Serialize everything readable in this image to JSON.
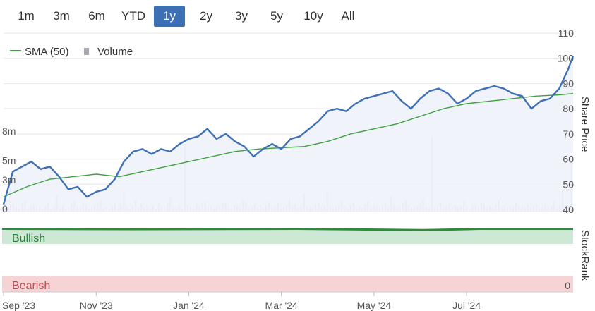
{
  "range_tabs": [
    {
      "label": "1m",
      "active": false
    },
    {
      "label": "3m",
      "active": false
    },
    {
      "label": "6m",
      "active": false
    },
    {
      "label": "YTD",
      "active": false
    },
    {
      "label": "1y",
      "active": true
    },
    {
      "label": "2y",
      "active": false
    },
    {
      "label": "3y",
      "active": false
    },
    {
      "label": "5y",
      "active": false
    },
    {
      "label": "10y",
      "active": false
    },
    {
      "label": "All",
      "active": false
    }
  ],
  "colors": {
    "price": "#3f6fb4",
    "sma": "#3fa13f",
    "volume": "#c0c0c8",
    "bullish": "#cde8d5",
    "bearish": "#f6d3d5",
    "stockrank": "#2f8a3a",
    "active_tab": "#3d70b2"
  },
  "chart_data": [
    {
      "type": "line",
      "legend": [
        {
          "name": "SMA (50)",
          "icon": "line"
        },
        {
          "name": "Volume",
          "icon": "bar"
        }
      ],
      "y_right_label": "Share Price",
      "ylim_right": [
        40,
        110
      ],
      "y_right_ticks": [
        "40",
        "50",
        "60",
        "70",
        "80",
        "90",
        "100",
        "110"
      ],
      "y_left_ticks": [
        "0",
        "3m",
        "5m",
        "8m"
      ],
      "ylim_left": [
        0,
        8
      ],
      "x_ticks": [
        "Sep '23",
        "Nov '23",
        "Jan '24",
        "Mar '24",
        "May '24",
        "Jul '24"
      ],
      "xlim": [
        0,
        12.3
      ],
      "x_tick_positions": [
        0,
        2,
        4,
        6,
        8,
        10
      ],
      "series": [
        {
          "kind": "price",
          "x": [
            0,
            0.2,
            0.4,
            0.6,
            0.8,
            1.0,
            1.1,
            1.2,
            1.4,
            1.6,
            1.8,
            2.0,
            2.2,
            2.4,
            2.6,
            2.8,
            3.0,
            3.2,
            3.4,
            3.6,
            3.8,
            4.0,
            4.2,
            4.4,
            4.6,
            4.8,
            5.0,
            5.2,
            5.4,
            5.6,
            5.8,
            6.0,
            6.2,
            6.4,
            6.6,
            6.8,
            7.0,
            7.2,
            7.4,
            7.6,
            7.8,
            8.0,
            8.2,
            8.4,
            8.6,
            8.8,
            9.0,
            9.2,
            9.4,
            9.6,
            9.8,
            10.0,
            10.2,
            10.4,
            10.6,
            10.8,
            11.0,
            11.2,
            11.4,
            11.6,
            11.8,
            12.0,
            12.1,
            12.2,
            12.3
          ],
          "y": [
            42,
            55,
            57,
            59,
            56,
            57,
            55,
            53,
            48,
            49,
            45,
            47,
            48,
            52,
            59,
            63,
            64,
            62,
            64,
            63,
            66,
            68,
            69,
            72,
            68,
            70,
            67,
            65,
            61,
            64,
            66,
            64,
            68,
            69,
            72,
            75,
            79,
            80,
            79,
            82,
            84,
            85,
            86,
            87,
            83,
            80,
            84,
            87,
            88,
            86,
            82,
            84,
            87,
            88,
            89,
            88,
            86,
            85,
            80,
            83,
            84,
            88,
            92,
            96,
            101
          ]
        },
        {
          "name": "SMA (50)",
          "x": [
            0,
            0.5,
            1.0,
            1.5,
            2.0,
            2.5,
            3.0,
            3.5,
            4.0,
            4.5,
            5.0,
            5.5,
            6.0,
            6.5,
            7.0,
            7.5,
            8.0,
            8.5,
            9.0,
            9.5,
            10.0,
            10.5,
            11.0,
            11.5,
            12.0,
            12.3
          ],
          "y": [
            45,
            49,
            52,
            53,
            54,
            53,
            55,
            57,
            59,
            61,
            63,
            64,
            64.5,
            65,
            67,
            70,
            72,
            74,
            77,
            80,
            82,
            83,
            84,
            85,
            85.5,
            86
          ]
        }
      ],
      "volume": [
        0.2,
        0.4,
        2.5,
        0.8,
        0.5,
        0.3,
        0.9,
        1.1,
        0.4,
        0.6,
        0.7,
        0.5,
        0.4,
        0.2,
        0.6,
        0.9,
        0.3,
        0.5,
        1.8,
        0.4,
        0.7,
        0.3,
        0.5,
        0.8,
        1.0,
        0.6,
        0.4,
        0.9,
        0.7,
        0.3,
        0.5,
        0.6,
        0.8,
        1.2,
        0.4,
        0.5,
        0.3,
        0.6,
        0.9,
        0.4,
        0.7,
        2.0,
        0.5,
        0.3,
        0.6,
        1.1,
        0.5,
        0.8,
        0.4,
        0.6,
        0.4,
        0.7,
        0.3,
        0.9,
        0.5,
        0.6,
        0.8,
        1.4,
        0.5,
        0.4,
        0.6,
        0.3,
        6.8,
        0.7,
        0.5,
        0.4,
        0.9,
        0.6,
        0.8,
        1.0,
        0.4,
        0.5,
        0.3,
        0.7,
        0.6,
        0.9,
        0.8,
        0.5,
        0.4,
        0.7,
        0.6,
        0.5,
        1.2,
        0.9,
        0.4,
        0.6,
        0.8,
        0.5,
        0.7,
        0.4,
        0.6,
        1.0,
        0.5,
        0.6,
        0.8,
        0.3,
        0.5,
        0.7,
        1.3,
        0.6,
        0.8,
        0.4,
        0.7,
        1.9,
        0.6,
        0.5,
        0.4,
        0.8,
        0.9,
        0.5,
        0.7,
        2.1,
        0.6,
        0.4,
        0.5,
        0.8,
        1.1,
        0.6,
        0.4,
        0.7,
        0.9,
        0.5,
        0.6,
        0.4,
        0.8,
        1.0,
        0.5,
        0.7,
        0.6,
        0.4,
        0.6,
        0.9,
        0.5,
        1.6,
        0.7,
        0.5,
        0.6,
        0.8,
        1.1,
        0.7,
        0.4,
        0.5,
        0.6,
        0.8,
        1.2,
        0.5,
        0.4,
        7.6,
        0.6,
        0.5,
        0.9,
        0.4,
        0.6,
        0.8,
        0.5,
        0.7,
        0.4,
        0.6,
        1.0,
        0.5,
        0.3,
        0.7,
        0.6,
        0.5,
        0.9,
        0.7,
        0.4,
        0.6,
        0.5,
        0.8,
        1.1,
        0.5,
        0.7,
        0.4,
        0.6,
        0.5,
        0.9,
        0.7,
        0.6,
        0.4,
        0.8,
        0.5,
        0.6,
        0.7,
        0.4,
        0.5,
        0.8,
        0.6,
        0.5,
        1.0,
        0.4,
        0.6,
        2.2,
        0.5,
        0.7,
        5.2
      ]
    },
    {
      "type": "area",
      "y_right_label": "StockRank",
      "y_right_ticks": [
        "0"
      ],
      "bands": [
        {
          "label": "Bullish",
          "zone": "top"
        },
        {
          "label": "Bearish",
          "zone": "bottom"
        }
      ],
      "stockrank_level": 0.96
    }
  ]
}
